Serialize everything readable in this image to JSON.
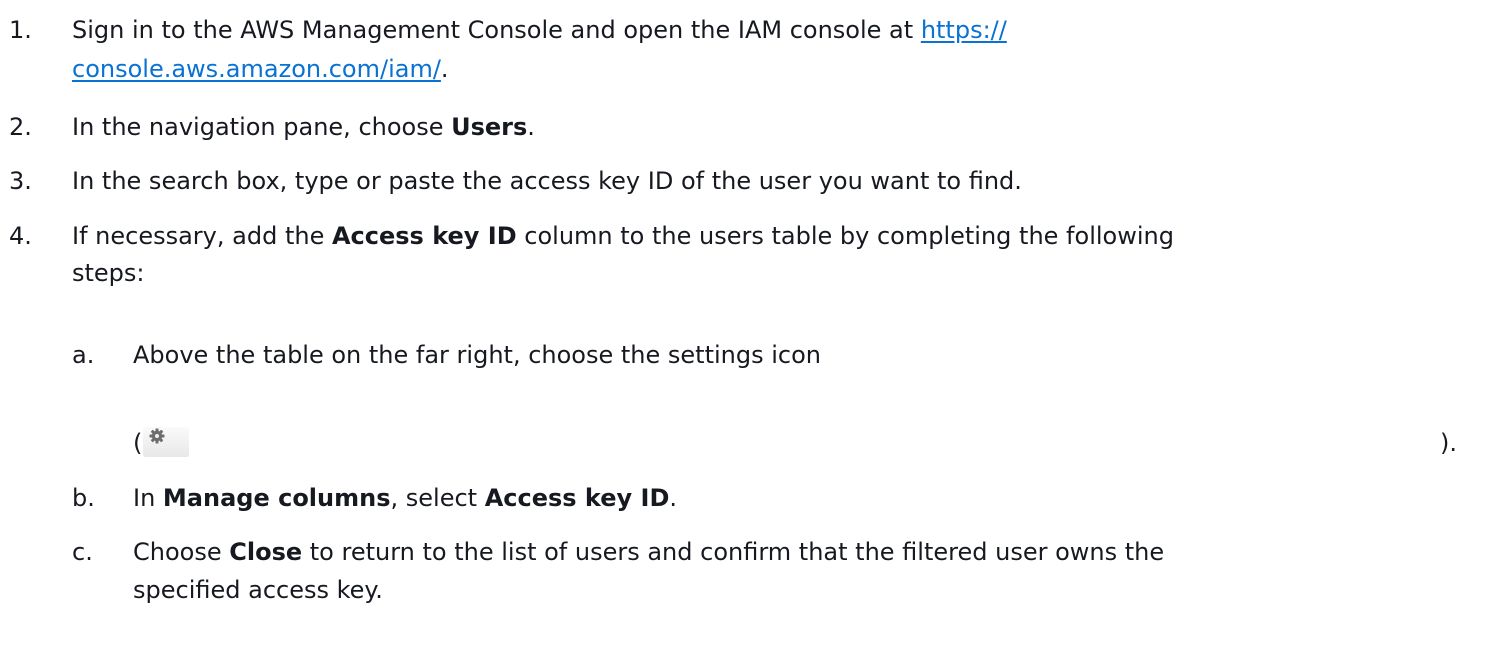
{
  "steps": [
    {
      "number": "1.",
      "pre": "Sign in to the AWS Management Console and open the IAM console at",
      "link_line1": "https://",
      "link_line2": "console.aws.amazon.com/iam/",
      "post": "."
    },
    {
      "number": "2.",
      "pre": "In the navigation pane, choose ",
      "bold": "Users",
      "post": "."
    },
    {
      "number": "3.",
      "text": "In the search box, type or paste the access key ID of the user you want to find."
    },
    {
      "number": "4.",
      "pre": "If necessary, add the ",
      "bold": "Access key ID",
      "post_line1": " column to the users table by completing the following",
      "post_line2": "steps:",
      "substeps": [
        {
          "letter": "a.",
          "text": "Above the table on the far right, choose the settings icon",
          "open_paren": "(",
          "close_paren": ").",
          "icon": "gear-icon"
        },
        {
          "letter": "b.",
          "pre": "In ",
          "bold1": "Manage columns",
          "mid": ", select ",
          "bold2": "Access key ID",
          "post": "."
        },
        {
          "letter": "c.",
          "pre": "Choose ",
          "bold": "Close",
          "post_line1": " to return to the list of users and confirm that the filtered user owns the",
          "post_line2": "specified access key."
        }
      ]
    }
  ]
}
